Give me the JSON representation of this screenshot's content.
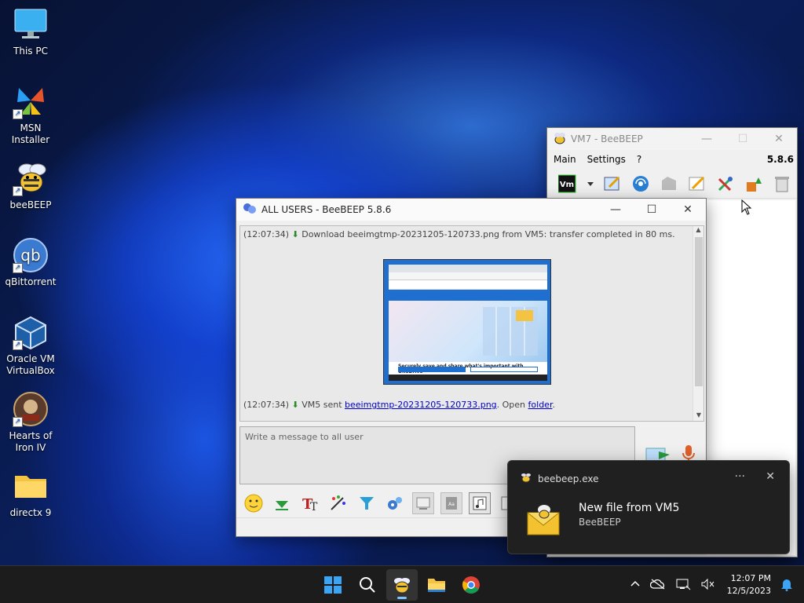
{
  "desktop": {
    "icons": [
      {
        "label": "This PC"
      },
      {
        "label": "MSN Installer"
      },
      {
        "label": "beeBEEP"
      },
      {
        "label": "qBittorrent"
      },
      {
        "label": "Oracle VM VirtualBox"
      },
      {
        "label": "Hearts of Iron IV"
      },
      {
        "label": "directx 9"
      }
    ]
  },
  "vm7_window": {
    "title": "VM7 - BeeBEEP",
    "menu": {
      "main": "Main",
      "settings": "Settings",
      "help": "?"
    },
    "version": "5.8.6"
  },
  "chat_window": {
    "title": "ALL USERS - BeeBEEP 5.8.6",
    "log": {
      "line1_time": "(12:07:34)",
      "line1_text": "Download beeimgtmp-20231205-120733.png from VM5: transfer completed in 80 ms.",
      "line2_time": "(12:07:34)",
      "line2_prefix": "VM5 sent",
      "line2_file": "beeimgtmp-20231205-120733.png",
      "line2_mid": ". Open",
      "line2_folder": "folder",
      "line2_end": "."
    },
    "thumbnail": {
      "heading": "Securely save and share what's important with OneDrive"
    },
    "input_placeholder": "Write a message to all user"
  },
  "notification": {
    "app": "beebeep.exe",
    "title": "New file from VM5",
    "body": "BeeBEEP",
    "more": "···",
    "close": "✕"
  },
  "taskbar": {
    "time": "12:07 PM",
    "date": "12/5/2023"
  },
  "colors": {
    "taskbar_bg": "#1c1c1c",
    "link": "#0000d0",
    "toast_bg": "#202020"
  }
}
